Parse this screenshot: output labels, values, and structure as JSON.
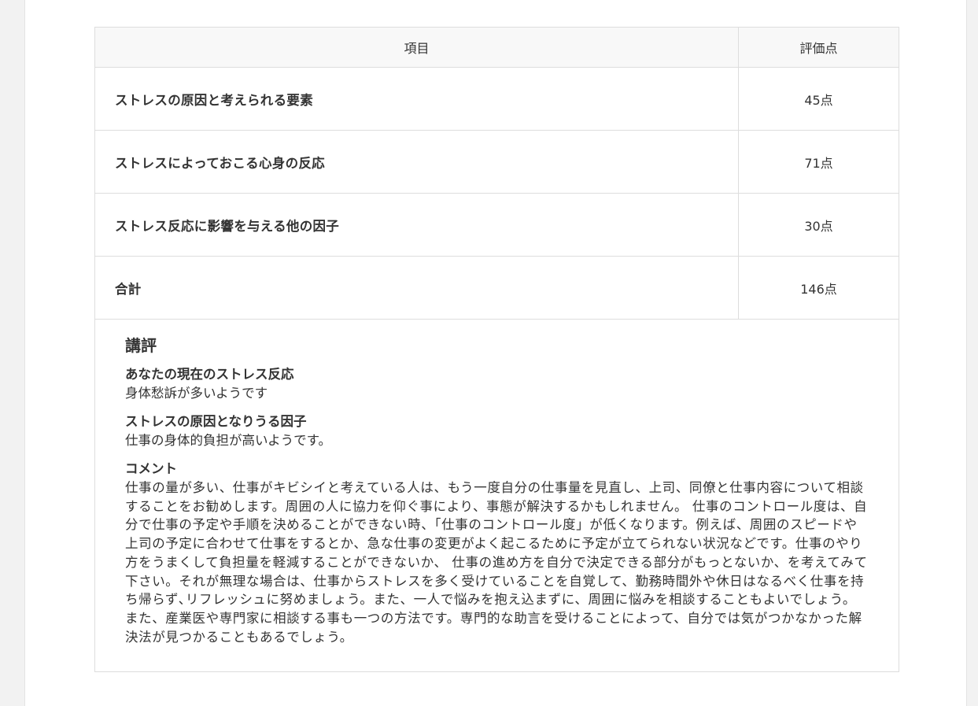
{
  "table": {
    "headers": {
      "item": "項目",
      "score": "評価点"
    },
    "rows": [
      {
        "item": "ストレスの原因と考えられる要素",
        "score": "45点"
      },
      {
        "item": "ストレスによっておこる心身の反応",
        "score": "71点"
      },
      {
        "item": "ストレス反応に影響を与える他の因子",
        "score": "30点"
      },
      {
        "item": "合計",
        "score": "146点"
      }
    ]
  },
  "review": {
    "title": "講評",
    "sections": [
      {
        "heading": "あなたの現在のストレス反応",
        "text": "身体愁訴が多いようです"
      },
      {
        "heading": "ストレスの原因となりうる因子",
        "text": "仕事の身体的負担が高いようです。"
      },
      {
        "heading": "コメント",
        "text": "仕事の量が多い、仕事がキビシイと考えている人は、もう一度自分の仕事量を見直し、上司、同僚と仕事内容について相談することをお勧めします。周囲の人に協力を仰ぐ事により、事態が解決するかもしれません。 仕事のコントロール度は、自分で仕事の予定や手順を決めることができない時、「仕事のコントロール度」が低くなります。例えば、周囲のスピードや上司の予定に合わせて仕事をするとか、急な仕事の変更がよく起こるために予定が立てられない状況などです。仕事のやり方をうまくして負担量を軽減することができないか、 仕事の進め方を自分で決定できる部分がもっとないか、を考えてみて下さい。それが無理な場合は、仕事からストレスを多く受けていることを自覚して、勤務時間外や休日はなるべく仕事を持ち帰らず､リフレッシュに努めましょう。また、一人で悩みを抱え込まずに、周囲に悩みを相談することもよいでしょう。また、産業医や専門家に相談する事も一つの方法です。専門的な助言を受けることによって、自分では気がつかなかった解決法が見つかることもあるでしょう。"
      }
    ]
  }
}
